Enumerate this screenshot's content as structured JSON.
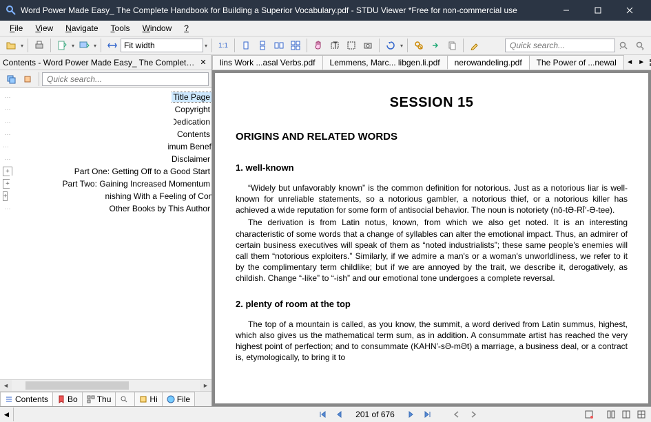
{
  "window": {
    "title": "Word Power Made Easy_ The Complete Handbook for Building a Superior Vocabulary.pdf - STDU Viewer *Free for non-commercial use"
  },
  "menu": [
    "File",
    "View",
    "Navigate",
    "Tools",
    "Window",
    "?"
  ],
  "toolbar": {
    "zoom_mode": "Fit width",
    "quick_search_placeholder": "Quick search..."
  },
  "leftpanel": {
    "title": "Contents - Word Power Made Easy_ The Complete Handbook for Building a Superior Vocabulary.pdf",
    "search_placeholder": "Quick search...",
    "tree": [
      {
        "label": "Title Page",
        "expandable": false,
        "selected": true
      },
      {
        "label": "Copyright",
        "expandable": false
      },
      {
        "label": "Dedication",
        "expandable": false
      },
      {
        "label": "Contents",
        "expandable": false
      },
      {
        "label": "How to Use This Book for Maximum Benefit",
        "expandable": false
      },
      {
        "label": "Disclaimer",
        "expandable": false
      },
      {
        "label": "Part One: Getting Off to a Good Start",
        "expandable": true
      },
      {
        "label": "Part Two: Gaining Increased Momentum",
        "expandable": true
      },
      {
        "label": "Part Three: Finishing With a Feeling of Complete Success",
        "expandable": true
      },
      {
        "label": "Other Books by This Author",
        "expandable": false
      }
    ],
    "tabs": [
      "Contents",
      "Bo",
      "Thu",
      "",
      "Hi",
      "File"
    ]
  },
  "doctabs": {
    "items": [
      {
        "label": "lins Work ...asal Verbs.pdf",
        "active": false
      },
      {
        "label": "Lemmens, Marc... libgen.li.pdf",
        "active": false
      },
      {
        "label": "nerowandeling.pdf",
        "active": true
      },
      {
        "label": "The Power of ...newal",
        "active": false
      }
    ]
  },
  "document": {
    "session_title": "SESSION 15",
    "heading": "ORIGINS AND RELATED WORDS",
    "sec1_head": "1. well-known",
    "sec1_p1": "“Widely but unfavorably known” is the common definition for notorious. Just as a notorious liar is well-known for unreliable statements, so a notorious gambler, a notorious thief, or a notorious killer has achieved a wide reputation for some form of antisocial behavior. The noun is notoriety (nō-tƏ-RĪ′-Ə-tee).",
    "sec1_p2": "The derivation is from Latin notus, known, from which we also get noted. It is an interesting characteristic of some words that a change of syllables can alter the emotional impact. Thus, an admirer of certain business executives will speak of them as “noted industrialists”; these same people's enemies will call them “notorious exploiters.” Similarly, if we admire a man's or a woman's unworldliness, we refer to it by the complimentary term childlike; but if we are annoyed by the trait, we describe it, derogatively, as childish. Change “-like” to “-ish” and our emotional tone undergoes a complete reversal.",
    "sec2_head": "2. plenty of room at the top",
    "sec2_p1": "The top of a mountain is called, as you know, the summit, a word derived from Latin summus, highest, which also gives us the mathematical term sum, as in addition. A consummate artist has reached the very highest point of perfection; and to consummate (KAHN′-sƏ-mƏt) a marriage, a business deal, or a contract is, etymologically, to bring it to"
  },
  "status": {
    "page_info": "201 of 676"
  }
}
